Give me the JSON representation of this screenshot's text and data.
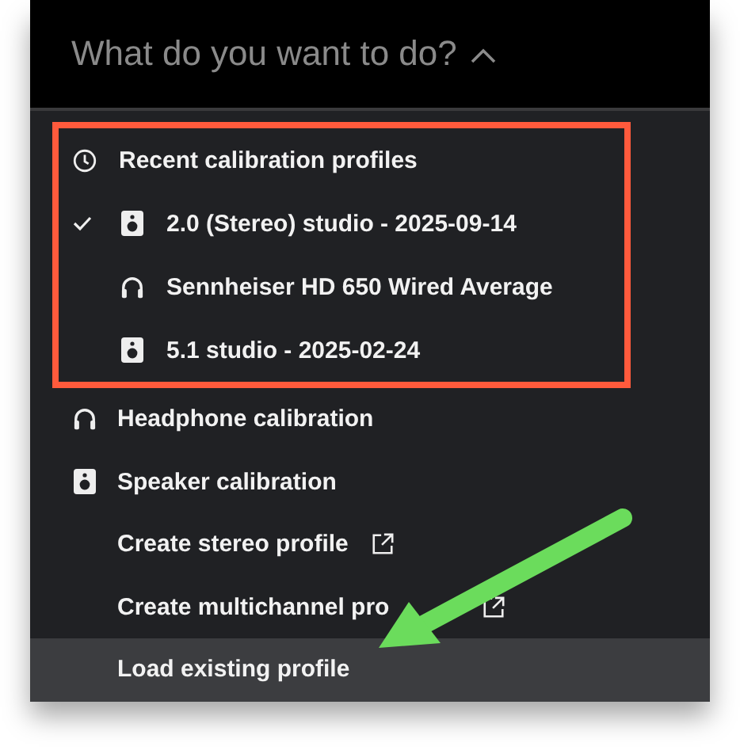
{
  "header": {
    "title": "What do you want to do?",
    "expanded": true
  },
  "recent": {
    "title": "Recent calibration profiles",
    "profiles": [
      {
        "label": "2.0 (Stereo) studio - 2025-09-14",
        "kind": "speaker",
        "selected": true
      },
      {
        "label": "Sennheiser HD 650 Wired Average",
        "kind": "headphones",
        "selected": false
      },
      {
        "label": "5.1 studio - 2025-02-24",
        "kind": "speaker",
        "selected": false
      }
    ]
  },
  "actions": [
    {
      "label": "Headphone calibration",
      "kind": "headphones",
      "external": false,
      "highlighted": false
    },
    {
      "label": "Speaker calibration",
      "kind": "speaker",
      "external": false,
      "highlighted": false
    },
    {
      "label": "Create stereo profile",
      "kind": "plain",
      "external": true,
      "highlighted": false
    },
    {
      "label": "Create multichannel pro",
      "kind": "plain",
      "external": true,
      "highlighted": false
    },
    {
      "label": "Load existing profile",
      "kind": "plain",
      "external": false,
      "highlighted": true
    }
  ]
}
